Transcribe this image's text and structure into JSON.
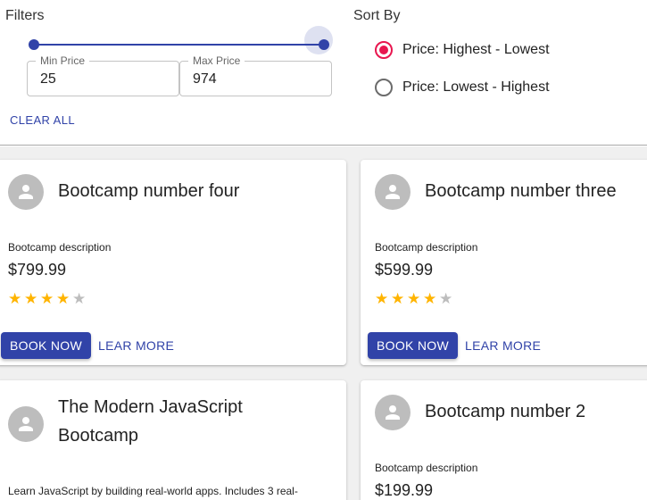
{
  "filters": {
    "title": "Filters",
    "price_range": {
      "min": 25,
      "max": 974,
      "min_label": "Min Price",
      "max_label": "Max Price",
      "min_value": "25",
      "max_value": "974"
    },
    "clear_all": "CLEAR ALL"
  },
  "sort": {
    "title": "Sort By",
    "options": [
      {
        "label": "Price: Highest - Lowest",
        "selected": true
      },
      {
        "label": "Price: Lowest - Highest",
        "selected": false
      }
    ]
  },
  "colors": {
    "primary": "#3143a8",
    "radio_selected": "#e8164f",
    "star": "#ffb400",
    "star_empty": "#bdbdbd",
    "background": "#f0f0f0"
  },
  "cards": [
    {
      "title": "Bootcamp number four",
      "description": "Bootcamp description",
      "price": "$799.99",
      "rating": 4,
      "book_label": "BOOK NOW",
      "learn_label": "LEAR MORE"
    },
    {
      "title": "Bootcamp number three",
      "description": "Bootcamp description",
      "price": "$599.99",
      "rating": 4,
      "book_label": "BOOK NOW",
      "learn_label": "LEAR MORE"
    },
    {
      "title_line1": "The Modern JavaScript",
      "title_line2": "Bootcamp",
      "description": "Learn JavaScript by building real-world apps. Includes 3 real-"
    },
    {
      "title": "Bootcamp number 2",
      "description": "Bootcamp description",
      "price": "$199.99"
    }
  ]
}
